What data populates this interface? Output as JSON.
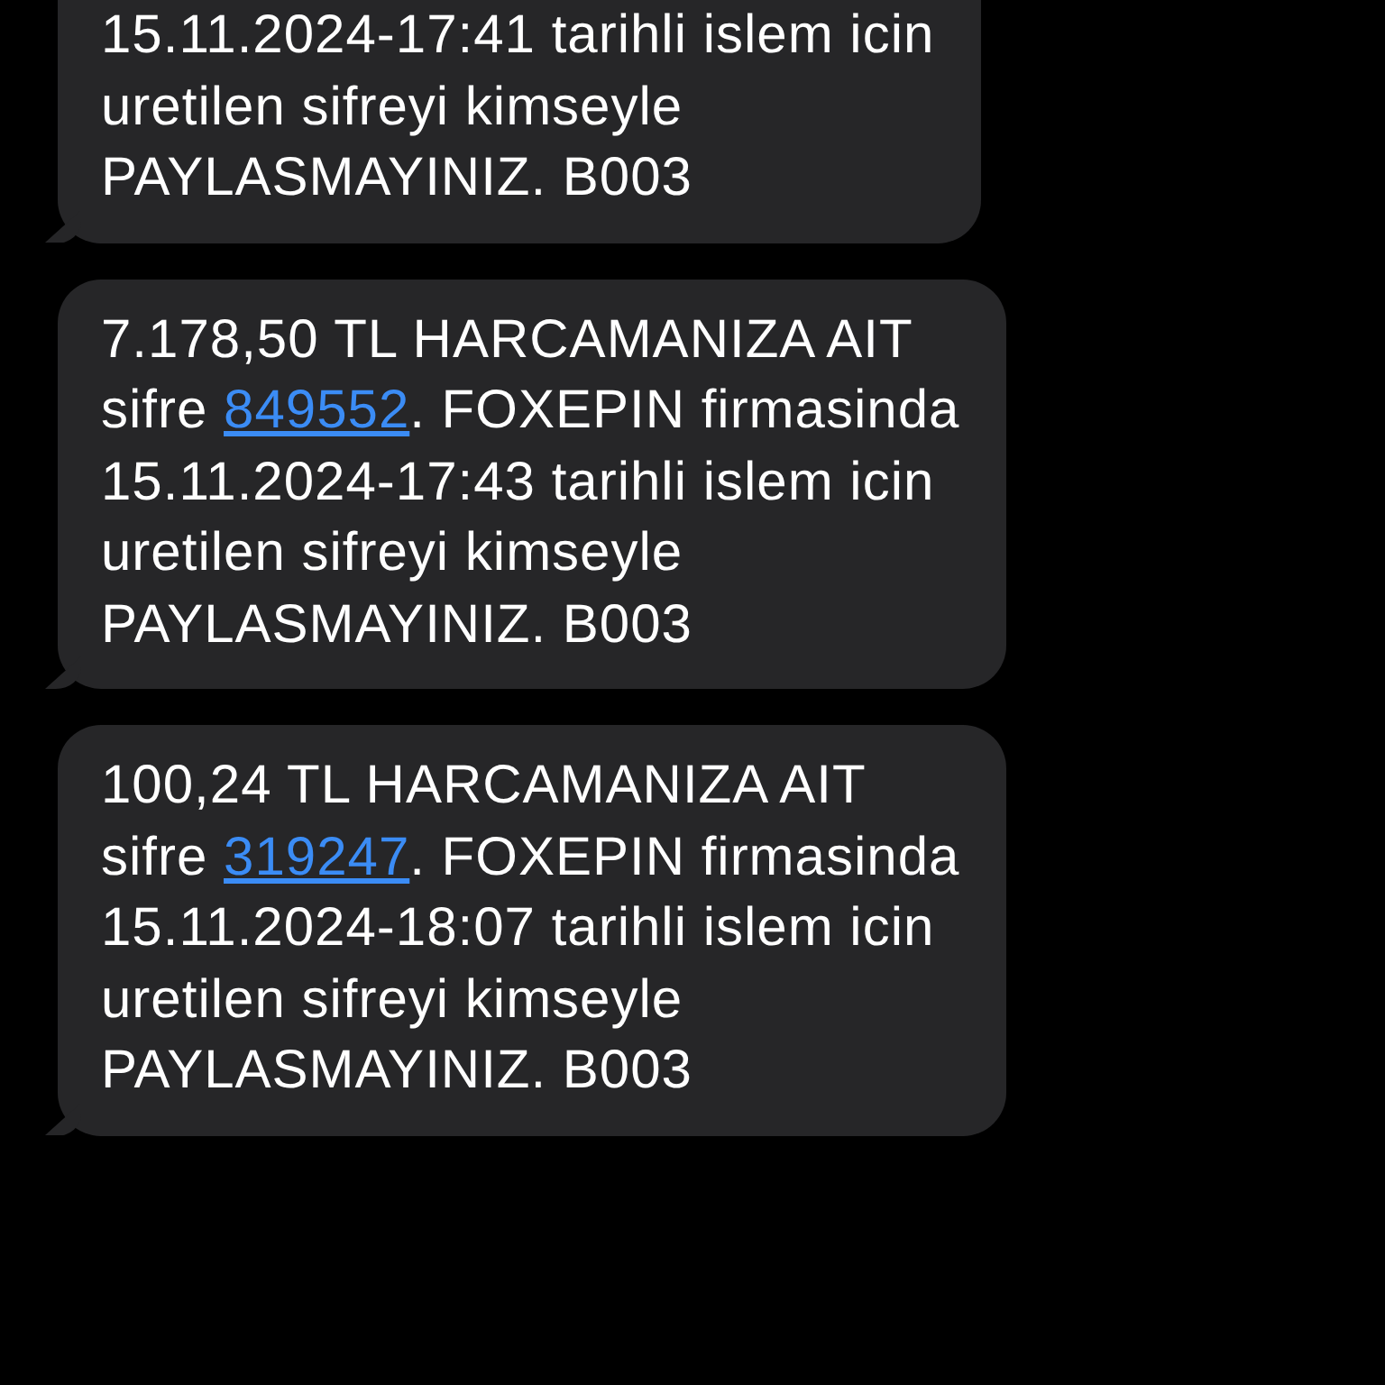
{
  "messages": [
    {
      "text_before": "15.11.2024-17:41 tarihli islem icin\nuretilen sifreyi kimseyle\nPAYLASMAYINIZ. B003"
    },
    {
      "text_before": "7.178,50 TL HARCAMANIZA AIT\nsifre ",
      "code": "849552",
      "text_after": ". FOXEPIN firmasinda\n15.11.2024-17:43 tarihli islem icin\nuretilen sifreyi kimseyle\nPAYLASMAYINIZ. B003"
    },
    {
      "text_before": "100,24 TL HARCAMANIZA AIT\nsifre ",
      "code": "319247",
      "text_after": ". FOXEPIN firmasinda\n15.11.2024-18:07 tarihli islem icin\nuretilen sifreyi kimseyle\nPAYLASMAYINIZ. B003"
    }
  ]
}
